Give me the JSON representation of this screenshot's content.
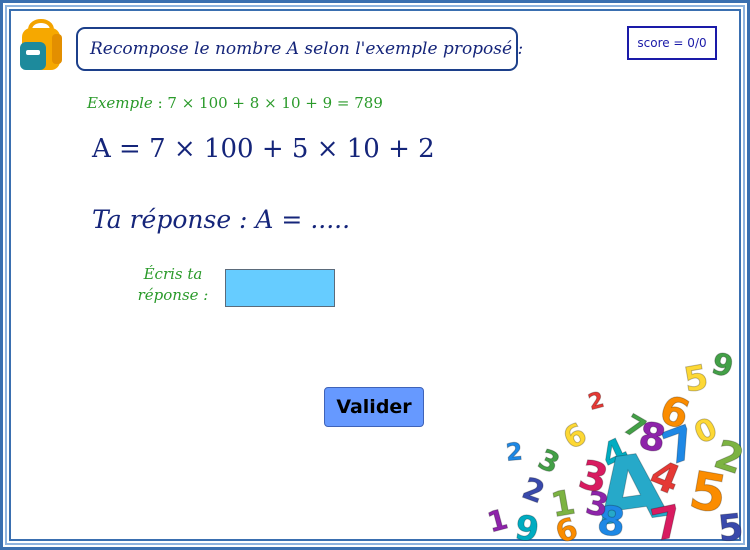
{
  "header": {
    "instruction": "Recompose le nombre A selon l'exemple proposé :",
    "score_label": "score = 0/0"
  },
  "exercise": {
    "example_label": "Exemple",
    "example_expression": " : 7 × 100 + 8 × 10 + 9 = 789",
    "formula": "A = 7 × 100 + 5 × 10  + 2",
    "answer_prompt": "Ta réponse : A = .....",
    "write_label": "Écris ta réponse :"
  },
  "answer_input": {
    "value": "",
    "placeholder": ""
  },
  "buttons": {
    "validate_label": "Valider"
  },
  "icons": {
    "backpack": "backpack-icon",
    "decoration": "numbers-pile-decoration"
  },
  "colors": {
    "frame": "#3a6fb0",
    "title_text": "#15257a",
    "green_text": "#2a9a2a",
    "input_fill": "#66ccff",
    "button_fill": "#6699ff"
  },
  "decoration_digits": [
    "2",
    "6",
    "5",
    "9",
    "7",
    "8",
    "4",
    "3",
    "1",
    "2",
    "A",
    "5",
    "6",
    "3",
    "8",
    "1",
    "9",
    "7",
    "2",
    "5",
    "4",
    "6",
    "0",
    "7",
    "2",
    "3"
  ]
}
